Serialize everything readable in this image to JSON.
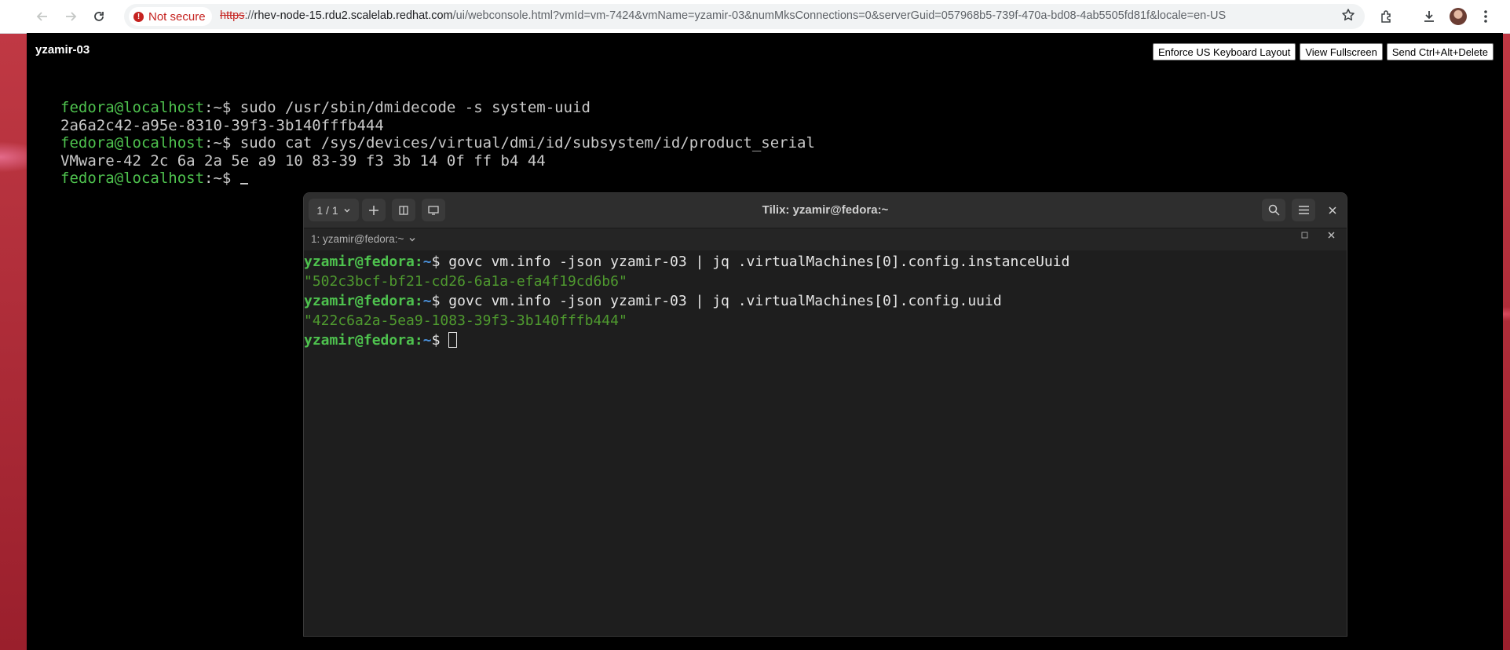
{
  "browser": {
    "security_label": "Not secure",
    "url_scheme": "https",
    "url_sep": "://",
    "url_host": "rhev-node-15.rdu2.scalelab.redhat.com",
    "url_path": "/ui/webconsole.html?vmId=vm-7424&vmName=yzamir-03&numMksConnections=0&serverGuid=057968b5-739f-470a-bd08-4ab5505fd81f&locale=en-US",
    "icons": [
      "back-icon",
      "forward-icon",
      "reload-icon",
      "star-icon",
      "extensions-icon",
      "download-icon",
      "avatar",
      "menu-icon"
    ]
  },
  "console": {
    "vm_name": "yzamir-03",
    "buttons": {
      "keyboard": "Enforce US Keyboard Layout",
      "fullscreen": "View Fullscreen",
      "ctrl_alt_del": "Send Ctrl+Alt+Delete"
    },
    "lines": [
      {
        "prompt": "fedora@localhost",
        "suffix": ":~$ ",
        "cmd": "sudo /usr/sbin/dmidecode -s system-uuid"
      },
      {
        "output": "2a6a2c42-a95e-8310-39f3-3b140fffb444"
      },
      {
        "prompt": "fedora@localhost",
        "suffix": ":~$ ",
        "cmd": "sudo cat /sys/devices/virtual/dmi/id/subsystem/id/product_serial"
      },
      {
        "output": "VMware-42 2c 6a 2a 5e a9 10 83-39 f3 3b 14 0f ff b4 44"
      },
      {
        "prompt": "fedora@localhost",
        "suffix": ":~$ ",
        "cmd": ""
      }
    ]
  },
  "tilix": {
    "session_counter": "1 / 1",
    "title": "Tilix: yzamir@fedora:~",
    "tab_label": "1: yzamir@fedora:~",
    "lines": [
      {
        "user": "yzamir@fedora",
        "path": "~",
        "cmd": "govc vm.info -json yzamir-03 | jq .virtualMachines[0].config.instanceUuid"
      },
      {
        "output": "\"502c3bcf-bf21-cd26-6a1a-efa4f19cd6b6\""
      },
      {
        "user": "yzamir@fedora",
        "path": "~",
        "cmd": "govc vm.info -json yzamir-03 | jq .virtualMachines[0].config.uuid"
      },
      {
        "output": "\"422c6a2a-5ea9-1083-39f3-3b140fffb444\""
      },
      {
        "user": "yzamir@fedora",
        "path": "~",
        "cmd": ""
      }
    ]
  }
}
